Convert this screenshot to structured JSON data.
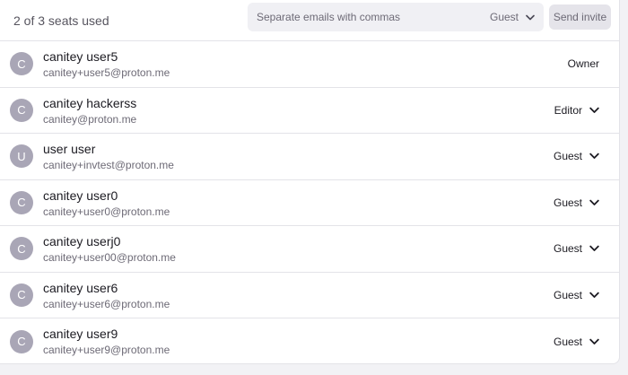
{
  "header": {
    "seats_text": "2 of 3 seats used",
    "invite_placeholder": "Separate emails with commas",
    "role_value": "Guest",
    "send_label": "Send invite"
  },
  "members": [
    {
      "initial": "C",
      "name": "canitey user5",
      "email": "canitey+user5@proton.me",
      "role": "Owner",
      "has_dropdown": false
    },
    {
      "initial": "C",
      "name": "canitey hackerss",
      "email": "canitey@proton.me",
      "role": "Editor",
      "has_dropdown": true
    },
    {
      "initial": "U",
      "name": "user user",
      "email": "canitey+invtest@proton.me",
      "role": "Guest",
      "has_dropdown": true
    },
    {
      "initial": "C",
      "name": "canitey user0",
      "email": "canitey+user0@proton.me",
      "role": "Guest",
      "has_dropdown": true
    },
    {
      "initial": "C",
      "name": "canitey userj0",
      "email": "canitey+user00@proton.me",
      "role": "Guest",
      "has_dropdown": true
    },
    {
      "initial": "C",
      "name": "canitey user6",
      "email": "canitey+user6@proton.me",
      "role": "Guest",
      "has_dropdown": true
    },
    {
      "initial": "C",
      "name": "canitey user9",
      "email": "canitey+user9@proton.me",
      "role": "Guest",
      "has_dropdown": true
    }
  ],
  "icons": {
    "dropdown": "chevron-down-icon"
  },
  "colors": {
    "avatar_bg": "#a9a6b6",
    "panel_bg": "#ffffff",
    "input_bg": "#f0f0f4"
  }
}
